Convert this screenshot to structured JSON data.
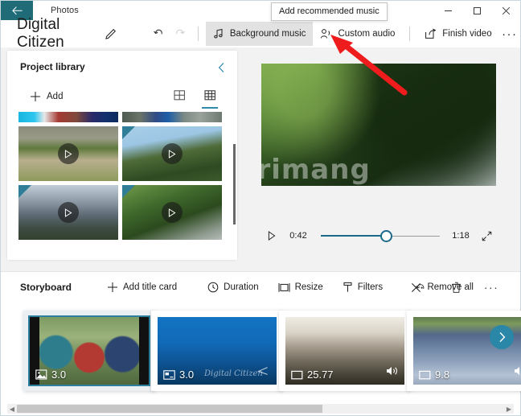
{
  "window": {
    "app_name": "Photos",
    "back_icon": "back-arrow-icon",
    "minimize_label": "─",
    "maximize_label": "□",
    "close_label": "✕"
  },
  "tooltip": {
    "text": "Add recommended music"
  },
  "commandbar": {
    "project_title": "Digital Citizen",
    "edit_icon": "pencil-icon",
    "undo_icon": "undo-icon",
    "redo_icon": "redo-icon",
    "background_music_label": "Background music",
    "background_music_icon": "music-note-icon",
    "custom_audio_label": "Custom audio",
    "custom_audio_icon": "person-audio-icon",
    "finish_video_label": "Finish video",
    "finish_video_icon": "export-icon",
    "more_label": "···"
  },
  "library": {
    "title": "Project library",
    "collapse_icon": "chevron-left-icon",
    "add_label": "Add",
    "add_icon": "plus-icon",
    "view_large_icon": "grid-large-icon",
    "view_small_icon": "grid-small-icon",
    "selected_view": "grid-small-icon",
    "items": [
      {
        "name": "clip-strip-1",
        "kind": "clip"
      },
      {
        "name": "clip-strip-2",
        "kind": "clip"
      },
      {
        "name": "video-playground",
        "kind": "video"
      },
      {
        "name": "video-forest-sky",
        "kind": "video"
      },
      {
        "name": "video-mountains",
        "kind": "video"
      },
      {
        "name": "video-tree-road",
        "kind": "video"
      }
    ]
  },
  "preview": {
    "play_icon": "play-icon",
    "current_time": "0:42",
    "total_time": "1:18",
    "expand_icon": "fullscreen-icon",
    "progress_percent": 55,
    "watermark": "ntrimang"
  },
  "storyboard": {
    "title": "Storyboard",
    "add_title_card_label": "Add title card",
    "add_title_card_icon": "plus-icon",
    "duration_label": "Duration",
    "duration_icon": "clock-icon",
    "resize_label": "Resize",
    "resize_icon": "resize-icon",
    "filters_label": "Filters",
    "filters_icon": "filter-brush-icon",
    "rotate_icon": "rotate-icon",
    "delete_icon": "trash-icon",
    "more_label": "···",
    "remove_all_label": "Remove all",
    "remove_all_icon": "close-x-icon",
    "next_icon": "chevron-right-icon",
    "cards": [
      {
        "name": "card-cyclists",
        "duration": "3.0",
        "type_icon": "photo-icon",
        "has_audio": false,
        "selected": true,
        "title_card": false
      },
      {
        "name": "card-title",
        "duration": "3.0",
        "type_icon": "titlecard-icon",
        "has_audio": false,
        "selected": false,
        "title_card": true,
        "watermark": "Digital Citizen"
      },
      {
        "name": "card-mountains",
        "duration": "25.77",
        "type_icon": "video-icon",
        "has_audio": true,
        "selected": false,
        "title_card": false
      },
      {
        "name": "card-lake",
        "duration": "9.8",
        "type_icon": "video-icon",
        "has_audio": true,
        "selected": false,
        "title_card": false
      }
    ]
  },
  "colors": {
    "accent": "#2e8bab",
    "back_button": "#1f6b78",
    "annotation": "#ee1c1c",
    "body_bg": "#f2f2f2"
  }
}
